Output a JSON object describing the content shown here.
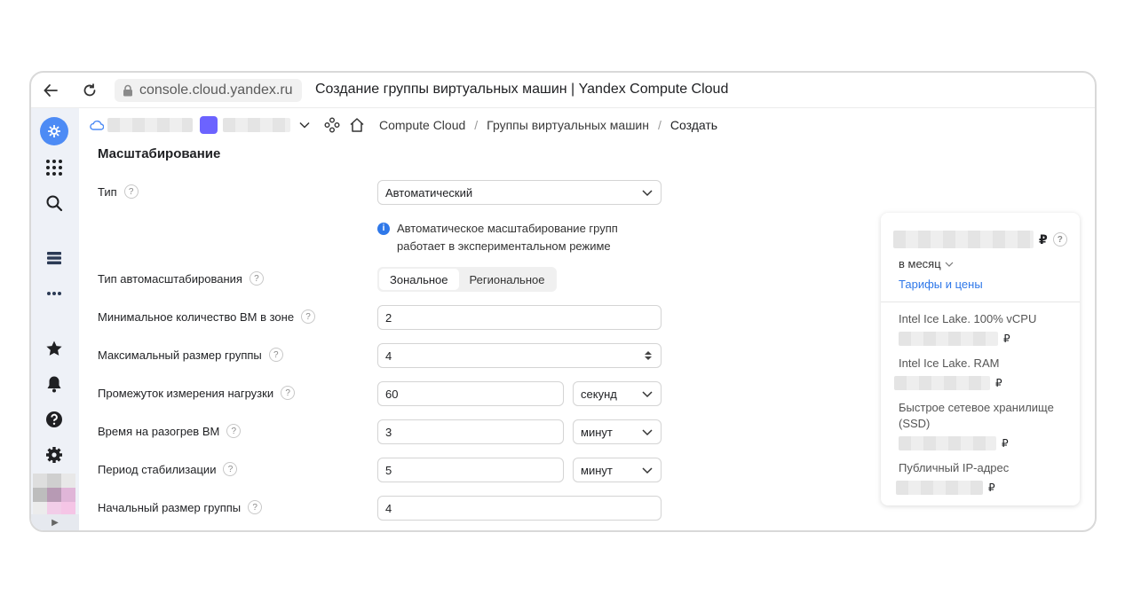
{
  "browser": {
    "url": "console.cloud.yandex.ru",
    "title": "Создание группы виртуальных машин | Yandex Compute Cloud"
  },
  "breadcrumbs": [
    "Compute Cloud",
    "Группы виртуальных машин",
    "Создать"
  ],
  "breadcrumb_sep": "/",
  "form": {
    "section_title": "Масштабирование",
    "type_label": "Тип",
    "type_value": "Автоматический",
    "info_line1": "Автоматическое масштабирование групп",
    "info_line2": "работает в экспериментальном режиме",
    "autoscale_type_label": "Тип автомасштабирования",
    "autoscale_options": [
      "Зональное",
      "Региональное"
    ],
    "autoscale_selected": "Зональное",
    "min_vm_label": "Минимальное количество ВМ в зоне",
    "min_vm_value": "2",
    "max_size_label": "Максимальный размер группы",
    "max_size_value": "4",
    "interval_label": "Промежуток измерения нагрузки",
    "interval_value": "60",
    "interval_unit": "секунд",
    "warmup_label": "Время на разогрев ВМ",
    "warmup_value": "3",
    "warmup_unit": "минут",
    "stabilization_label": "Период стабилизации",
    "stabilization_value": "5",
    "stabilization_unit": "минут",
    "initial_size_label": "Начальный размер группы",
    "initial_size_value": "4",
    "help_glyph": "?"
  },
  "pricing": {
    "currency": "₽",
    "period": "в месяц",
    "tariffs_link": "Тарифы и цены",
    "items": [
      "Intel Ice Lake. 100% vCPU",
      "Intel Ice Lake. RAM",
      "Быстрое сетевое хранилище (SSD)",
      "Публичный IP-адрес"
    ]
  },
  "colors": {
    "accent": "#4d8bf5",
    "link": "#2f78e9",
    "sidebar_bg": "#eef1f7"
  }
}
